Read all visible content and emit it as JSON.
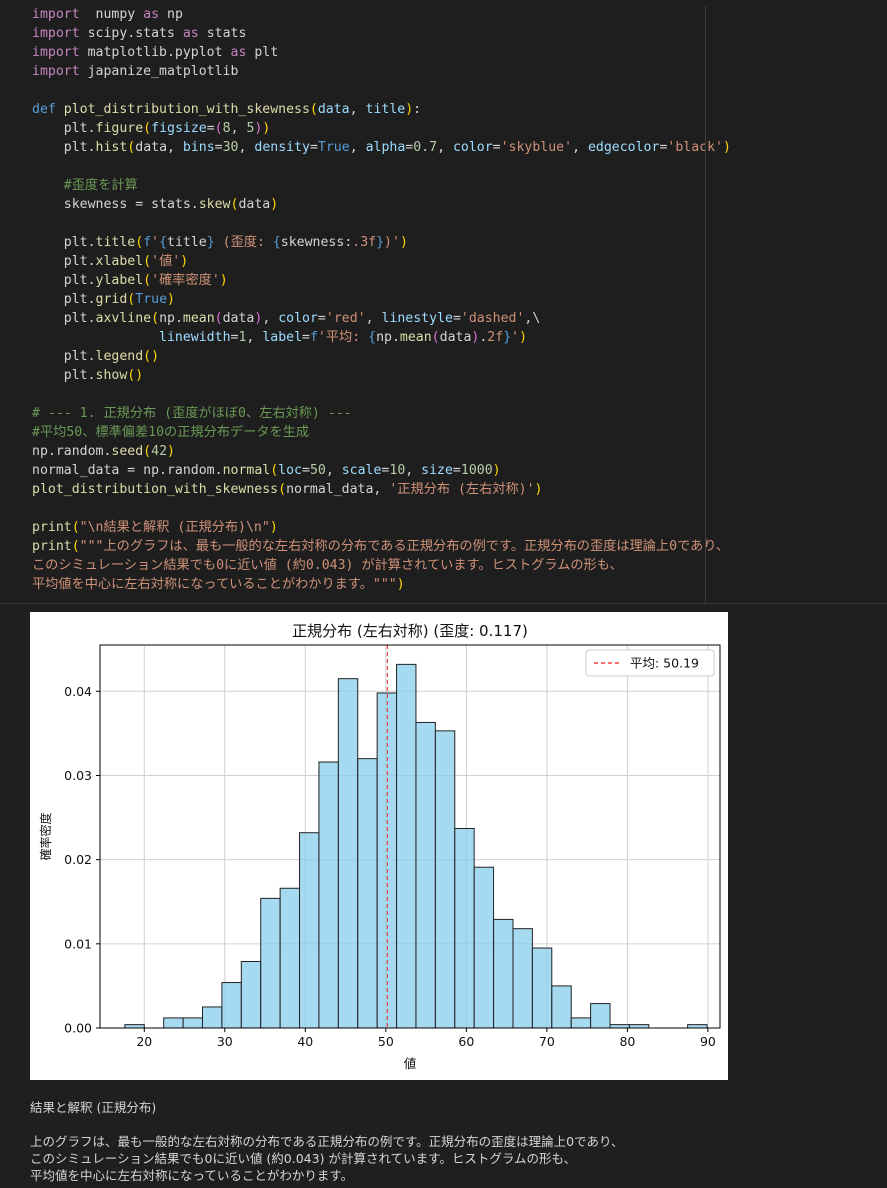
{
  "code": {
    "lines": [
      [
        [
          "kw",
          "import"
        ],
        [
          "",
          "  numpy "
        ],
        [
          "kw",
          "as"
        ],
        [
          "",
          " np"
        ]
      ],
      [
        [
          "kw",
          "import"
        ],
        [
          "",
          " scipy.stats "
        ],
        [
          "kw",
          "as"
        ],
        [
          "",
          " stats"
        ]
      ],
      [
        [
          "kw",
          "import"
        ],
        [
          "",
          " matplotlib.pyplot "
        ],
        [
          "kw",
          "as"
        ],
        [
          "",
          " plt"
        ]
      ],
      [
        [
          "kw",
          "import"
        ],
        [
          "",
          " japanize_matplotlib"
        ]
      ],
      [],
      [
        [
          "def",
          "def "
        ],
        [
          "fn",
          "plot_distribution_with_skewness"
        ],
        [
          "par",
          "("
        ],
        [
          "var",
          "data"
        ],
        [
          "",
          ", "
        ],
        [
          "var",
          "title"
        ],
        [
          "par",
          ")"
        ],
        [
          "",
          ":"
        ]
      ],
      [
        [
          "",
          "    plt."
        ],
        [
          "fn",
          "figure"
        ],
        [
          "par",
          "("
        ],
        [
          "var",
          "figsize"
        ],
        [
          "",
          "="
        ],
        [
          "par2",
          "("
        ],
        [
          "num",
          "8"
        ],
        [
          "",
          ", "
        ],
        [
          "num",
          "5"
        ],
        [
          "par2",
          ")"
        ],
        [
          "par",
          ")"
        ]
      ],
      [
        [
          "",
          "    plt."
        ],
        [
          "fn",
          "hist"
        ],
        [
          "par",
          "("
        ],
        [
          "",
          "data, "
        ],
        [
          "var",
          "bins"
        ],
        [
          "",
          "="
        ],
        [
          "num",
          "30"
        ],
        [
          "",
          ", "
        ],
        [
          "var",
          "density"
        ],
        [
          "",
          "="
        ],
        [
          "bool",
          "True"
        ],
        [
          "",
          ", "
        ],
        [
          "var",
          "alpha"
        ],
        [
          "",
          "="
        ],
        [
          "num",
          "0.7"
        ],
        [
          "",
          ", "
        ],
        [
          "var",
          "color"
        ],
        [
          "",
          "="
        ],
        [
          "str",
          "'skyblue'"
        ],
        [
          "",
          ", "
        ],
        [
          "var",
          "edgecolor"
        ],
        [
          "",
          "="
        ],
        [
          "str",
          "'black'"
        ],
        [
          "par",
          ")"
        ]
      ],
      [],
      [
        [
          "com",
          "    #歪度を計算"
        ]
      ],
      [
        [
          "",
          "    skewness = stats."
        ],
        [
          "fn",
          "skew"
        ],
        [
          "par",
          "("
        ],
        [
          "",
          "data"
        ],
        [
          "par",
          ")"
        ]
      ],
      [],
      [
        [
          "",
          "    plt."
        ],
        [
          "fn",
          "title"
        ],
        [
          "par",
          "("
        ],
        [
          "fpre",
          "f"
        ],
        [
          "str",
          "'"
        ],
        [
          "def",
          "{"
        ],
        [
          "",
          "title"
        ],
        [
          "def",
          "}"
        ],
        [
          "str",
          " (歪度: "
        ],
        [
          "def",
          "{"
        ],
        [
          "",
          "skewness:"
        ],
        [
          "str",
          ".3f"
        ],
        [
          "def",
          "}"
        ],
        [
          "str",
          ")'"
        ],
        [
          "par",
          ")"
        ]
      ],
      [
        [
          "",
          "    plt."
        ],
        [
          "fn",
          "xlabel"
        ],
        [
          "par",
          "("
        ],
        [
          "str",
          "'値'"
        ],
        [
          "par",
          ")"
        ]
      ],
      [
        [
          "",
          "    plt."
        ],
        [
          "fn",
          "ylabel"
        ],
        [
          "par",
          "("
        ],
        [
          "str",
          "'確率密度'"
        ],
        [
          "par",
          ")"
        ]
      ],
      [
        [
          "",
          "    plt."
        ],
        [
          "fn",
          "grid"
        ],
        [
          "par",
          "("
        ],
        [
          "bool",
          "True"
        ],
        [
          "par",
          ")"
        ]
      ],
      [
        [
          "",
          "    plt."
        ],
        [
          "fn",
          "axvline"
        ],
        [
          "par",
          "("
        ],
        [
          "",
          "np."
        ],
        [
          "fn",
          "mean"
        ],
        [
          "par2",
          "("
        ],
        [
          "",
          "data"
        ],
        [
          "par2",
          ")"
        ],
        [
          "",
          ", "
        ],
        [
          "var",
          "color"
        ],
        [
          "",
          "="
        ],
        [
          "str",
          "'red'"
        ],
        [
          "",
          ", "
        ],
        [
          "var",
          "linestyle"
        ],
        [
          "",
          "="
        ],
        [
          "str",
          "'dashed'"
        ],
        [
          "",
          ",\\"
        ]
      ],
      [
        [
          "",
          "                "
        ],
        [
          "var",
          "linewidth"
        ],
        [
          "",
          "="
        ],
        [
          "num",
          "1"
        ],
        [
          "",
          ", "
        ],
        [
          "var",
          "label"
        ],
        [
          "",
          "="
        ],
        [
          "fpre",
          "f"
        ],
        [
          "str",
          "'平均: "
        ],
        [
          "def",
          "{"
        ],
        [
          "",
          "np."
        ],
        [
          "fn",
          "mean"
        ],
        [
          "par2",
          "("
        ],
        [
          "",
          "data"
        ],
        [
          "par2",
          ")"
        ],
        [
          "",
          "."
        ],
        [
          "str",
          "2f"
        ],
        [
          "def",
          "}"
        ],
        [
          "str",
          "'"
        ],
        [
          "par",
          ")"
        ]
      ],
      [
        [
          "",
          "    plt."
        ],
        [
          "fn",
          "legend"
        ],
        [
          "par",
          "()"
        ]
      ],
      [
        [
          "",
          "    plt."
        ],
        [
          "fn",
          "show"
        ],
        [
          "par",
          "()"
        ]
      ],
      [],
      [
        [
          "com",
          "# --- 1. 正規分布 (歪度がほぼ0、左右対称) ---"
        ]
      ],
      [
        [
          "com",
          "#平均50、標準偏差10の正規分布データを生成"
        ]
      ],
      [
        [
          "",
          "np.random."
        ],
        [
          "fn",
          "seed"
        ],
        [
          "par",
          "("
        ],
        [
          "num",
          "42"
        ],
        [
          "par",
          ")"
        ]
      ],
      [
        [
          "",
          "normal_data = np.random."
        ],
        [
          "fn",
          "normal"
        ],
        [
          "par",
          "("
        ],
        [
          "var",
          "loc"
        ],
        [
          "",
          "="
        ],
        [
          "num",
          "50"
        ],
        [
          "",
          ", "
        ],
        [
          "var",
          "scale"
        ],
        [
          "",
          "="
        ],
        [
          "num",
          "10"
        ],
        [
          "",
          ", "
        ],
        [
          "var",
          "size"
        ],
        [
          "",
          "="
        ],
        [
          "num",
          "1000"
        ],
        [
          "par",
          ")"
        ]
      ],
      [
        [
          "fn",
          "plot_distribution_with_skewness"
        ],
        [
          "par",
          "("
        ],
        [
          "",
          "normal_data, "
        ],
        [
          "str",
          "'正規分布 (左右対称)'"
        ],
        [
          "par",
          ")"
        ]
      ],
      [],
      [
        [
          "fn",
          "print"
        ],
        [
          "par",
          "("
        ],
        [
          "str",
          "\"\\n結果と解釈 (正規分布)\\n\""
        ],
        [
          "par",
          ")"
        ]
      ],
      [
        [
          "fn",
          "print"
        ],
        [
          "par",
          "("
        ],
        [
          "str",
          "\"\"\"上のグラフは、最も一般的な左右対称の分布である正規分布の例です。正規分布の歪度は理論上0であり、"
        ]
      ],
      [
        [
          "str",
          "このシミュレーション結果でも0に近い値 (約0.043) が計算されています。ヒストグラムの形も、"
        ]
      ],
      [
        [
          "str",
          "平均値を中心に左右対称になっていることがわかります。\"\"\""
        ],
        [
          "par",
          ")"
        ]
      ]
    ]
  },
  "chart_data": {
    "type": "bar",
    "title": "正規分布 (左右対称) (歪度: 0.117)",
    "xlabel": "値",
    "ylabel": "確率密度",
    "xlim": [
      14.5,
      91.5
    ],
    "ylim": [
      0,
      0.0455
    ],
    "x_ticks": [
      20,
      30,
      40,
      50,
      60,
      70,
      80,
      90
    ],
    "y_ticks": [
      0.0,
      0.01,
      0.02,
      0.03,
      0.04
    ],
    "y_tick_labels": [
      "0.00",
      "0.01",
      "0.02",
      "0.03",
      "0.04"
    ],
    "grid": true,
    "bar_color": "#87ceeb",
    "bin_edges": [
      17.59,
      20.0,
      22.41,
      24.82,
      27.23,
      29.64,
      32.05,
      34.46,
      36.87,
      39.28,
      41.69,
      44.1,
      46.51,
      48.92,
      51.33,
      53.74,
      56.15,
      58.56,
      60.97,
      63.38,
      65.79,
      68.2,
      70.61,
      73.02,
      75.43,
      77.84,
      80.25,
      82.66,
      85.07,
      87.48,
      89.89
    ],
    "values": [
      0.0004,
      0.0,
      0.0012,
      0.0012,
      0.0025,
      0.0054,
      0.0079,
      0.0154,
      0.0166,
      0.0232,
      0.0316,
      0.0415,
      0.032,
      0.0398,
      0.0432,
      0.0363,
      0.0353,
      0.0237,
      0.0191,
      0.0129,
      0.0118,
      0.0095,
      0.005,
      0.0012,
      0.0029,
      0.0004,
      0.0004,
      0.0,
      0.0,
      0.0004
    ],
    "mean_line": {
      "x": 50.19,
      "color": "#ee4444",
      "label": "平均: 50.19"
    },
    "legend_position": "upper-right"
  },
  "output": {
    "heading": "結果と解釈 (正規分布)",
    "lines": [
      "上のグラフは、最も一般的な左右対称の分布である正規分布の例です。正規分布の歪度は理論上0であり、",
      "このシミュレーション結果でも0に近い値 (約0.043) が計算されています。ヒストグラムの形も、",
      "平均値を中心に左右対称になっていることがわかります。"
    ]
  }
}
